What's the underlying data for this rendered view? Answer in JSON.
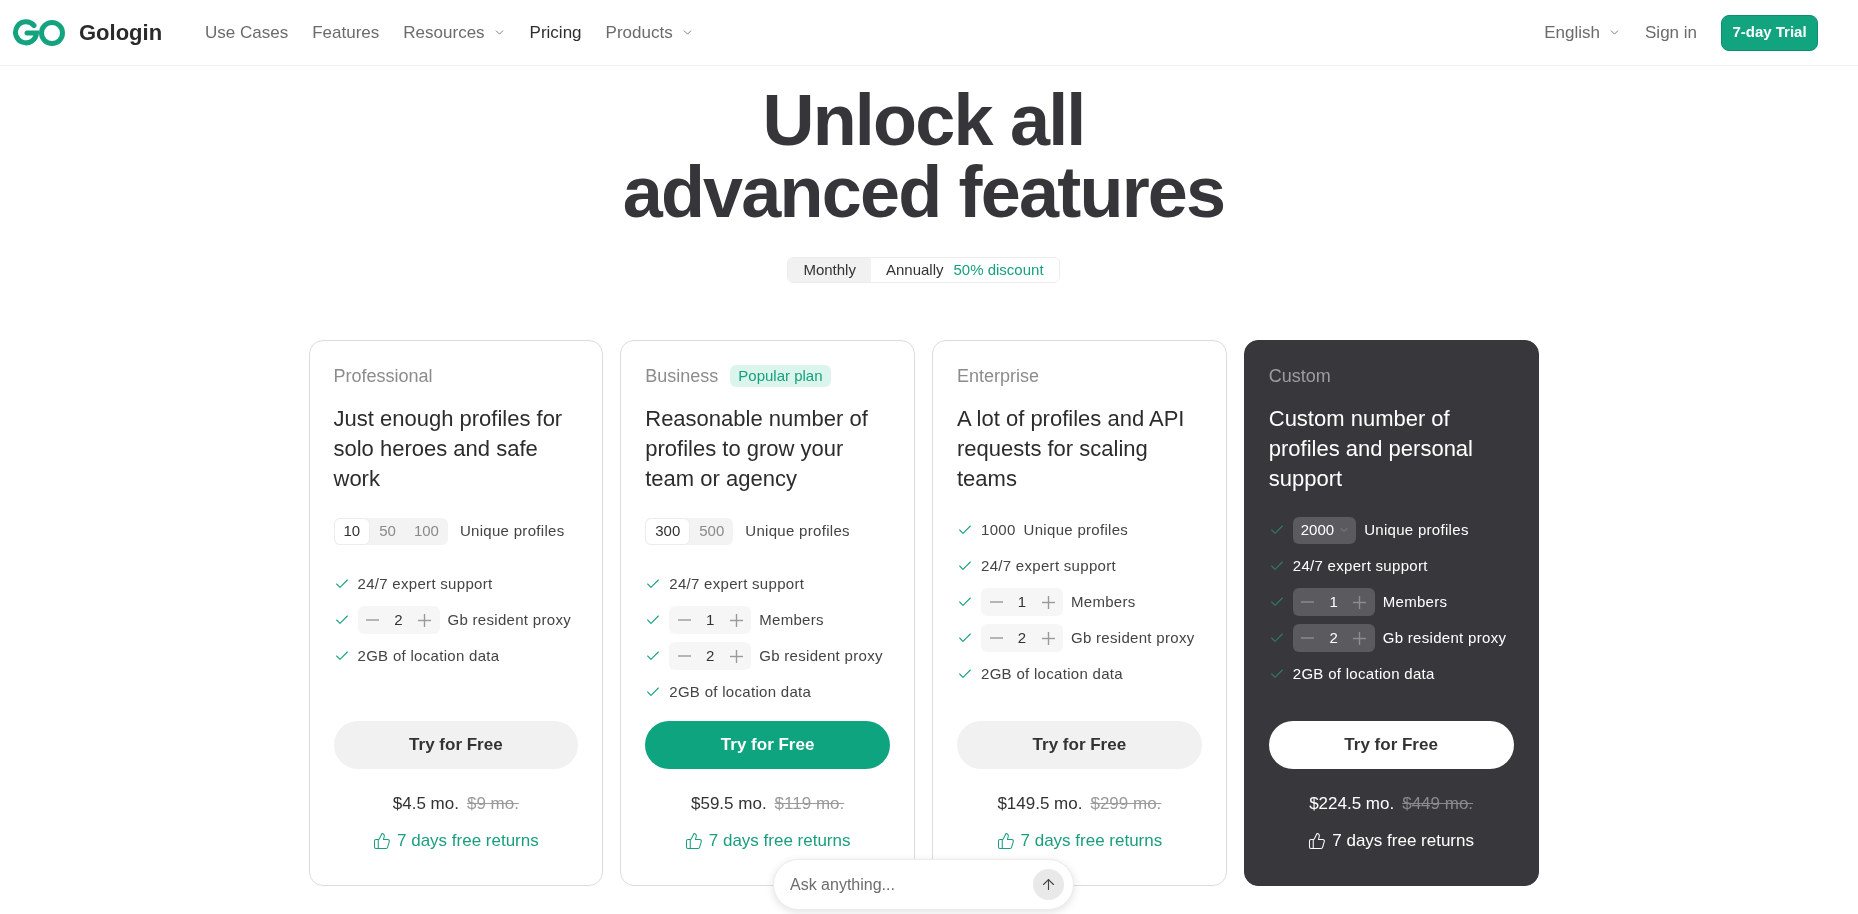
{
  "header": {
    "brand": "Gologin",
    "nav": [
      {
        "label": "Use Cases",
        "dropdown": false,
        "selected": false
      },
      {
        "label": "Features",
        "dropdown": false,
        "selected": false
      },
      {
        "label": "Resources",
        "dropdown": true,
        "selected": false
      },
      {
        "label": "Pricing",
        "dropdown": false,
        "selected": true
      },
      {
        "label": "Products",
        "dropdown": true,
        "selected": false
      }
    ],
    "language": "English",
    "sign_in": "Sign in",
    "trial_button": "7-day Trial"
  },
  "hero": {
    "title": "Unlock all advanced features"
  },
  "billing": {
    "tabs": [
      {
        "label": "Monthly",
        "selected": true
      },
      {
        "label": "Annually",
        "selected": false,
        "note": "50% discount"
      }
    ]
  },
  "plans": [
    {
      "kind": "basic",
      "name": "Professional",
      "heading": "Just enough profiles for solo heroes and safe work",
      "profiles": {
        "options": [
          {
            "label": "10",
            "selected": true
          },
          {
            "label": "50",
            "selected": false
          },
          {
            "label": "100",
            "selected": false
          }
        ],
        "label": "Unique profiles"
      },
      "features": [
        {
          "kind": "text",
          "label": "24/7 expert support"
        },
        {
          "kind": "stepper",
          "stepper": {
            "value": "2"
          },
          "label": "Gb resident proxy"
        },
        {
          "kind": "text",
          "label": "2GB of location data"
        }
      ],
      "button": "Try for Free",
      "price": "$4.5 mo.",
      "old_price": "$9 mo.",
      "returns": "7 days free returns"
    },
    {
      "kind": "popular",
      "name": "Business",
      "badge": "Popular plan",
      "heading": "Reasonable number of profiles to grow your team or agency",
      "profiles": {
        "options": [
          {
            "label": "300",
            "selected": true
          },
          {
            "label": "500",
            "selected": false
          }
        ],
        "label": "Unique profiles"
      },
      "features": [
        {
          "kind": "text",
          "label": "24/7 expert support"
        },
        {
          "kind": "stepper",
          "stepper": {
            "value": "1"
          },
          "label": "Members"
        },
        {
          "kind": "stepper",
          "stepper": {
            "value": "2"
          },
          "label": "Gb resident proxy"
        },
        {
          "kind": "text",
          "label": "2GB of location data"
        }
      ],
      "button": "Try for Free",
      "price": "$59.5 mo.",
      "old_price": "$119 mo.",
      "returns": "7 days free returns"
    },
    {
      "kind": "basic",
      "name": "Enterprise",
      "heading": "A lot of profiles and API requests for scaling teams",
      "features": [
        {
          "kind": "value",
          "value": "1000",
          "label": "Unique profiles"
        },
        {
          "kind": "text",
          "label": "24/7 expert support"
        },
        {
          "kind": "stepper",
          "stepper": {
            "value": "1"
          },
          "label": "Members"
        },
        {
          "kind": "stepper",
          "stepper": {
            "value": "2"
          },
          "label": "Gb resident proxy"
        },
        {
          "kind": "text",
          "label": "2GB of location data"
        }
      ],
      "button": "Try for Free",
      "price": "$149.5 mo.",
      "old_price": "$299 mo.",
      "returns": "7 days free returns"
    },
    {
      "kind": "dark",
      "name": "Custom",
      "heading": "Custom number of profiles and personal support",
      "features": [
        {
          "kind": "select",
          "value": "2000",
          "label": "Unique profiles"
        },
        {
          "kind": "text",
          "label": "24/7 expert support"
        },
        {
          "kind": "stepper",
          "stepper": {
            "value": "1"
          },
          "label": "Members"
        },
        {
          "kind": "stepper",
          "stepper": {
            "value": "2"
          },
          "label": "Gb resident proxy"
        },
        {
          "kind": "text",
          "label": "2GB of location data"
        }
      ],
      "button": "Try for Free",
      "price": "$224.5 mo.",
      "old_price": "$449 mo.",
      "returns": "7 days free returns"
    }
  ],
  "chat": {
    "placeholder": "Ask anything..."
  }
}
